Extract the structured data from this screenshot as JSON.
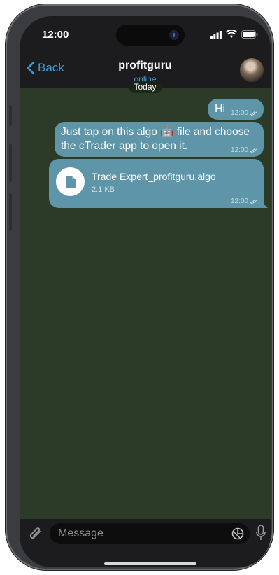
{
  "status_bar": {
    "time": "12:00"
  },
  "header": {
    "back_label": "Back",
    "contact_name": "profitguru",
    "contact_status": "online",
    "accent_color": "#3f9bd8"
  },
  "chat": {
    "date_separator": "Today",
    "messages": [
      {
        "text": "Hi",
        "time": "12:00"
      },
      {
        "text_line1": "Just tap on this algo 🤖 file and choose",
        "text_line2": "the cTrader app to open it.",
        "time": "12:00"
      },
      {
        "file_name": "Trade Expert_profitguru.algo",
        "file_size": "2.1 KB",
        "time": "12:00"
      }
    ],
    "bubble_color": "#5e95a8",
    "wallpaper_color": "#2c3b28"
  },
  "composer": {
    "placeholder": "Message"
  },
  "icons": {
    "attach": "paperclip-icon",
    "sticker": "sticker-icon",
    "mic": "microphone-icon",
    "file": "document-icon"
  }
}
